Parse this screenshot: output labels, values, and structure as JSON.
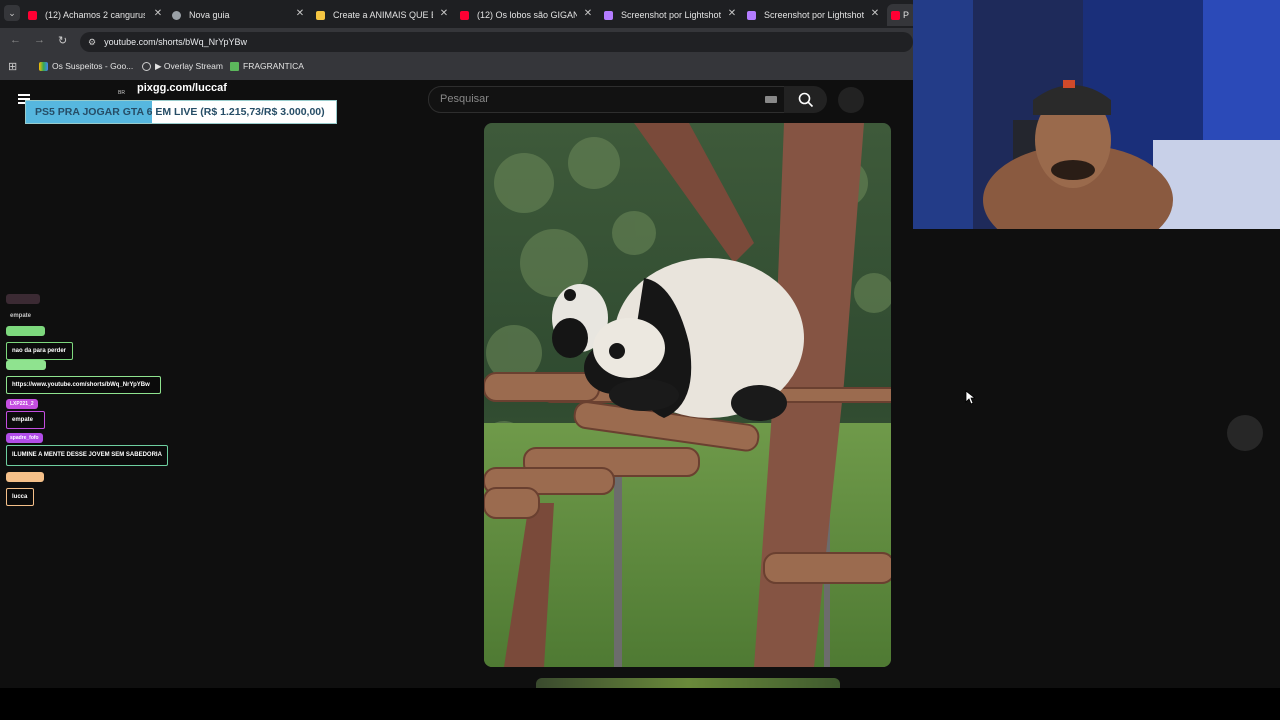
{
  "browser": {
    "tabs": [
      {
        "title": "(12) Achamos 2 cangurus b",
        "favicon": "youtube-icon",
        "color": "#ff0033"
      },
      {
        "title": "Nova guia",
        "favicon": "chrome-icon",
        "color": "#9aa0a6"
      },
      {
        "title": "Create a ANIMAIS QUE EU",
        "favicon": "document-icon",
        "color": "#f4c542"
      },
      {
        "title": "(12) Os lobos são GIGANT",
        "favicon": "youtube-icon",
        "color": "#ff0033"
      },
      {
        "title": "Screenshot por Lightshot",
        "favicon": "feather-icon",
        "color": "#b47cff"
      },
      {
        "title": "Screenshot por Lightshot",
        "favicon": "feather-icon",
        "color": "#b47cff"
      },
      {
        "title": "P",
        "favicon": "youtube-icon",
        "color": "#ff0033"
      }
    ],
    "url": "youtube.com/shorts/bWq_NrYpYBw",
    "bookmarks": [
      {
        "label": "Os Suspeitos - Goo...",
        "icon": "google-drive-icon"
      },
      {
        "label": "▶ Overlay Stream",
        "icon": "globe-icon"
      },
      {
        "label": "FRAGRANTICA",
        "icon": "fragrantica-icon"
      }
    ]
  },
  "youtube": {
    "search_placeholder": "Pesquisar",
    "country": "BR"
  },
  "overlay": {
    "brand": "pixgg.com/luccaf",
    "goal_text": "PS5 PRA JOGAR GTA 6 EM LIVE (R$ 1.215,73/R$ 3.000,00)",
    "goal_progress": 0.405
  },
  "chat": [
    {
      "user": "",
      "message": "empate",
      "color": "#3b2a33"
    },
    {
      "user": "",
      "message": "nao da para perder",
      "color": "#7dd87d"
    },
    {
      "user": "",
      "message": "https://www.youtube.com/shorts/bWq_NrYpYBw",
      "color": "#8fe38f"
    },
    {
      "user": "LXP221_2",
      "message": "empate",
      "color": "#c44ee0"
    },
    {
      "user": "spadre_fofo",
      "message": "ILUMINE A MENTE DESSE JOVEM SEM SABEDORIA",
      "color": "#b24de8"
    },
    {
      "user": "",
      "message": "lucca",
      "color": "#f5c089"
    }
  ]
}
